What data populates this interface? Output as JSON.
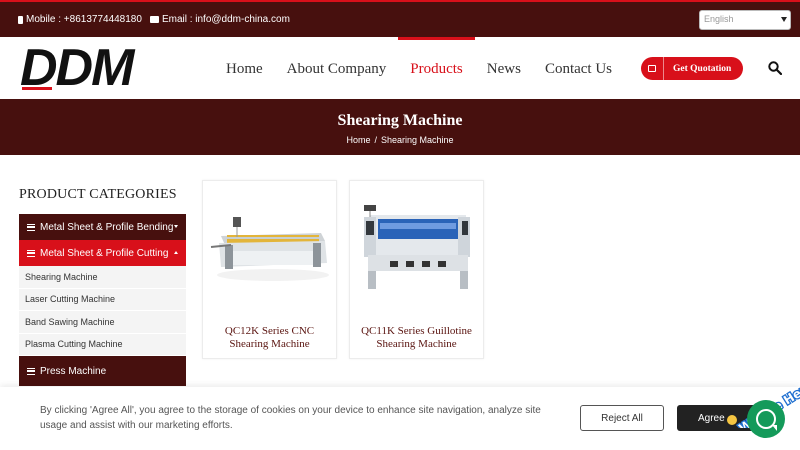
{
  "topbar": {
    "mobile": "Mobile : +8613774448180",
    "email": "Email : info@ddm-china.com",
    "language": "English"
  },
  "header": {
    "logo_text": "DDM",
    "nav": [
      {
        "label": "Home"
      },
      {
        "label": "About Company"
      },
      {
        "label": "Products",
        "active": true
      },
      {
        "label": "News"
      },
      {
        "label": "Contact Us"
      }
    ],
    "quote_label": "Get Quotation"
  },
  "banner": {
    "title": "Shearing Machine",
    "breadcrumb": [
      "Home",
      "/",
      "Shearing Machine"
    ]
  },
  "sidebar": {
    "title": "PRODUCT CATEGORIES",
    "categories": [
      {
        "label": "Metal Sheet & Profile Bending"
      },
      {
        "label": "Metal Sheet & Profile Cutting"
      },
      {
        "label": "Press Machine"
      }
    ],
    "subitems": [
      {
        "label": "Shearing Machine"
      },
      {
        "label": "Laser Cutting Machine"
      },
      {
        "label": "Band Sawing Machine"
      },
      {
        "label": "Plasma Cutting Machine"
      }
    ]
  },
  "products": [
    {
      "name": "QC12K Series CNC Shearing Machine"
    },
    {
      "name": "QC11K Series Guillotine Shearing Machine"
    }
  ],
  "cookie": {
    "text": "By clicking 'Agree All', you agree to the storage of cookies on your device to enhance site navigation, analyze site usage and assist with our marketing efforts.",
    "reject_label": "Reject All",
    "agree_label": "Agree"
  },
  "chat": {
    "badge_text": "We Are Here!"
  },
  "colors": {
    "brand_dark": "#47100e",
    "accent_red": "#d8101a",
    "chat_green": "#149a5a"
  }
}
